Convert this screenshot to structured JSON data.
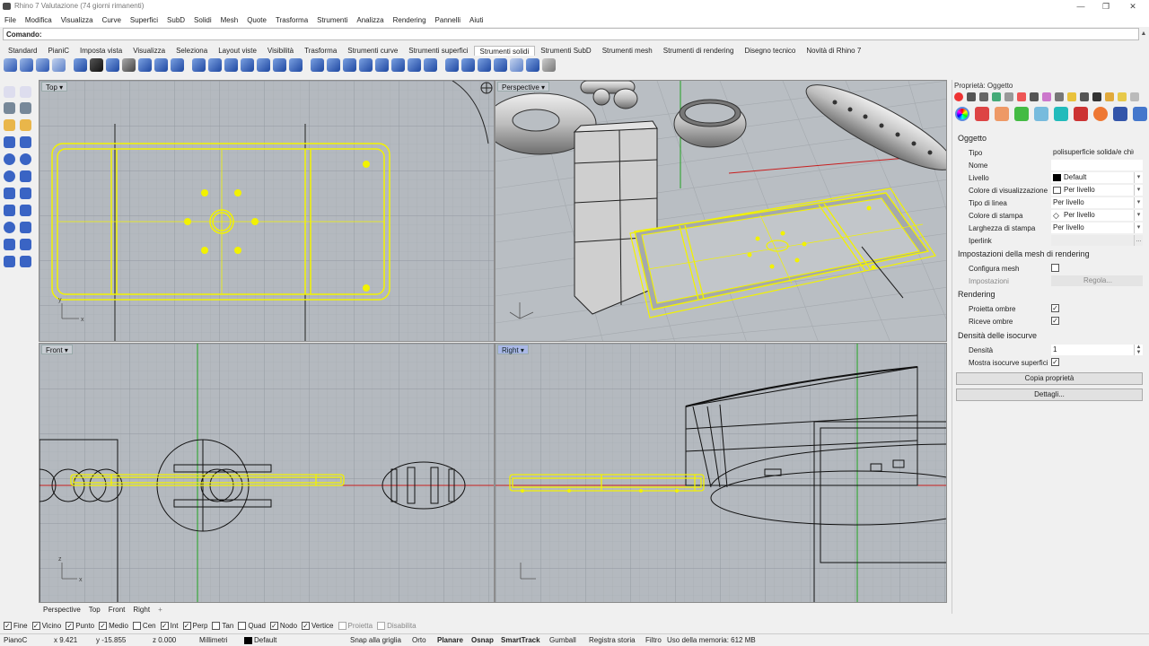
{
  "window": {
    "title": "Rhino 7 Valutazione (74 giorni rimanenti)",
    "minimize": "—",
    "maximize": "❐",
    "close": "✕"
  },
  "menu": [
    "File",
    "Modifica",
    "Visualizza",
    "Curve",
    "Superfici",
    "SubD",
    "Solidi",
    "Mesh",
    "Quote",
    "Trasforma",
    "Strumenti",
    "Analizza",
    "Rendering",
    "Pannelli",
    "Aiuti"
  ],
  "command": {
    "label": "Comando:",
    "value": ""
  },
  "tabs": [
    "Standard",
    "PianiC",
    "Imposta vista",
    "Visualizza",
    "Seleziona",
    "Layout viste",
    "Visibilità",
    "Trasforma",
    "Strumenti curve",
    "Strumenti superfici",
    "Strumenti solidi",
    "Strumenti SubD",
    "Strumenti mesh",
    "Strumenti di rendering",
    "Disegno tecnico",
    "Novità di Rhino 7"
  ],
  "active_tab": "Strumenti solidi",
  "viewports": {
    "top": "Top",
    "perspective": "Perspective",
    "front": "Front",
    "right": "Right",
    "active": "Right"
  },
  "viewport_tabs": [
    "Perspective",
    "Top",
    "Front",
    "Right"
  ],
  "viewport_tab_add": "+",
  "colors": {
    "selection": "#f2f200",
    "viewport_bg": "#b4b9bf",
    "grid_minor": "#a6abb1",
    "grid_major": "#9298a0",
    "axis_x": "#c81e1e",
    "axis_y": "#21a321"
  },
  "properties": {
    "title": "Proprietà: Oggetto",
    "section_object": "Oggetto",
    "rows": [
      {
        "label": "Tipo",
        "value": "polisuperficie solida/e chiu..."
      },
      {
        "label": "Nome",
        "value": ""
      },
      {
        "label": "Livello",
        "value": "Default"
      },
      {
        "label": "Colore di visualizzazione",
        "value": "Per livello"
      },
      {
        "label": "Tipo di linea",
        "value": "Per livello"
      },
      {
        "label": "Colore di stampa",
        "value": "Per livello"
      },
      {
        "label": "Larghezza di stampa",
        "value": "Per livello"
      },
      {
        "label": "Iperlink",
        "value": ""
      }
    ],
    "hyperlink_button": "...",
    "section_mesh": "Impostazioni della mesh di rendering",
    "custom_mesh_label": "Configura mesh",
    "settings_label": "Impostazioni",
    "adjust_button": "Regola...",
    "section_rendering": "Rendering",
    "cast_shadows": "Proietta ombre",
    "receive_shadows": "Riceve ombre",
    "section_isocurve": "Densità delle isocurve",
    "density_label": "Densità",
    "density_value": "1",
    "show_iso_label": "Mostra isocurve superfici",
    "copy_button": "Copia proprietà",
    "details_button": "Dettagli..."
  },
  "osnaps": [
    {
      "label": "Fine",
      "checked": true
    },
    {
      "label": "Vicino",
      "checked": true
    },
    {
      "label": "Punto",
      "checked": true
    },
    {
      "label": "Medio",
      "checked": true
    },
    {
      "label": "Cen",
      "checked": false
    },
    {
      "label": "Int",
      "checked": true
    },
    {
      "label": "Perp",
      "checked": true
    },
    {
      "label": "Tan",
      "checked": false
    },
    {
      "label": "Quad",
      "checked": false
    },
    {
      "label": "Nodo",
      "checked": true
    },
    {
      "label": "Vertice",
      "checked": true
    },
    {
      "label": "Proietta",
      "checked": false,
      "disabled": true
    },
    {
      "label": "Disabilita",
      "checked": false,
      "disabled": true
    }
  ],
  "status": {
    "cplane": "PianoC",
    "x": "x 9.421",
    "y": "y -15.855",
    "z": "z 0.000",
    "units": "Millimetri",
    "layer": "Default",
    "grid_snap": "Snap alla griglia",
    "ortho": "Orto",
    "planar": "Planare",
    "osnap": "Osnap",
    "smarttrack": "SmartTrack",
    "gumball": "Gumball",
    "history": "Registra storia",
    "filter": "Filtro",
    "memory": "Uso della memoria: 612 MB"
  },
  "axis_labels": {
    "x": "x",
    "y": "y",
    "z": "z"
  }
}
